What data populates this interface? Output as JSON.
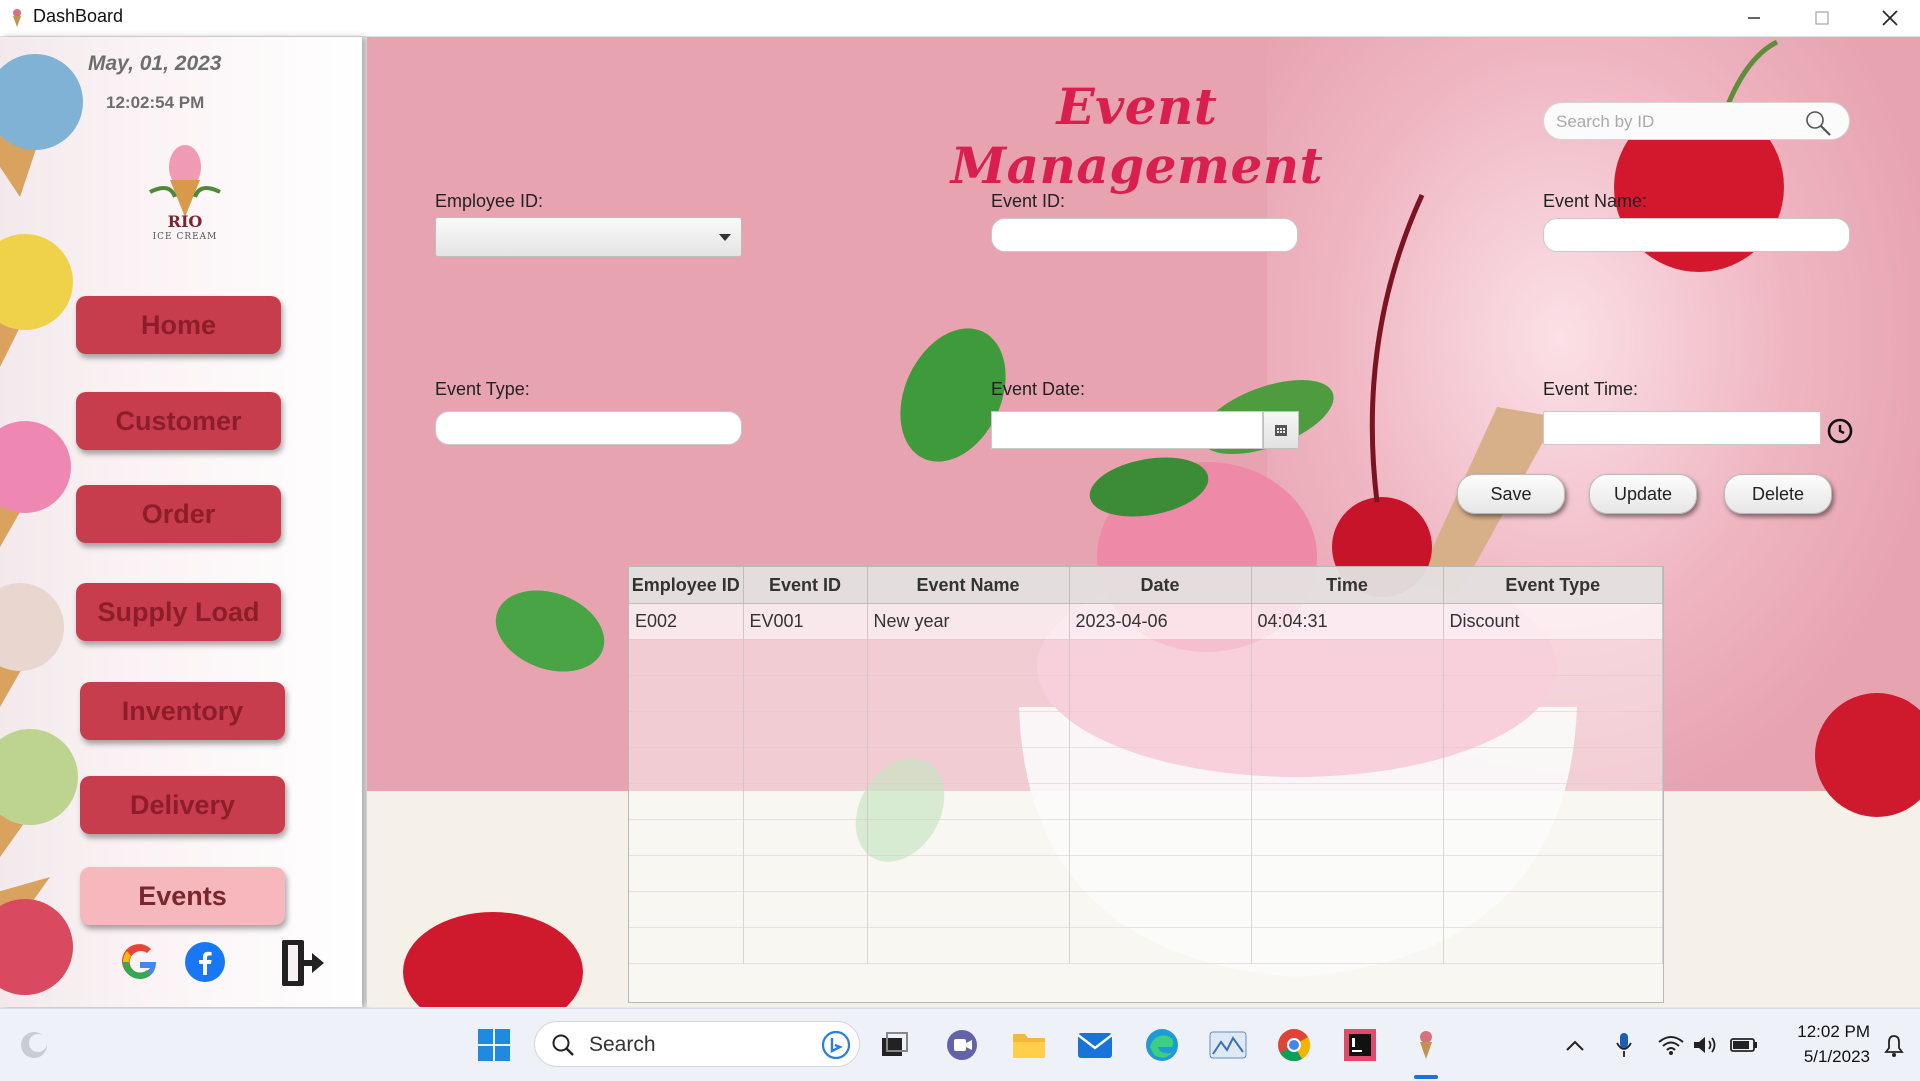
{
  "window": {
    "title": "DashBoard"
  },
  "sidebar": {
    "date": "May,  01, 2023",
    "time": "12:02:54 PM",
    "logo": {
      "brand": "RIO",
      "sub": "ICE CREAM"
    },
    "nav": {
      "home": "Home",
      "customer": "Customer",
      "order": "Order",
      "supply_load": "Supply Load",
      "inventory": "Inventory",
      "delivery": "Delivery",
      "events": "Events"
    },
    "social_icons": [
      "google-icon",
      "facebook-icon",
      "logout-icon"
    ]
  },
  "main": {
    "title": "Event Management",
    "search": {
      "placeholder": "Search by ID",
      "value": ""
    },
    "labels": {
      "employee_id": "Employee ID:",
      "event_id": "Event ID:",
      "event_name": "Event Name:",
      "event_type": "Event Type:",
      "event_date": "Event Date:",
      "event_time": "Event Time:"
    },
    "values": {
      "employee_id": "",
      "event_id": "",
      "event_name": "",
      "event_type": "",
      "event_date": "",
      "event_time": ""
    },
    "buttons": {
      "save": "Save",
      "update": "Update",
      "delete": "Delete"
    },
    "table": {
      "columns": [
        "Employee ID",
        "Event ID",
        "Event Name",
        "Date",
        "Time",
        "Event Type"
      ],
      "rows": [
        [
          "E002",
          "EV001",
          "New year",
          "2023-04-06",
          "04:04:31",
          "Discount"
        ]
      ]
    }
  },
  "taskbar": {
    "search_label": "Search",
    "clock_time": "12:02 PM",
    "clock_date": "5/1/2023"
  },
  "colors": {
    "nav_button": "#c83d4d",
    "nav_active": "#f6b7bd",
    "title": "#d91f4e",
    "main_bg": "#e7a3b0"
  }
}
